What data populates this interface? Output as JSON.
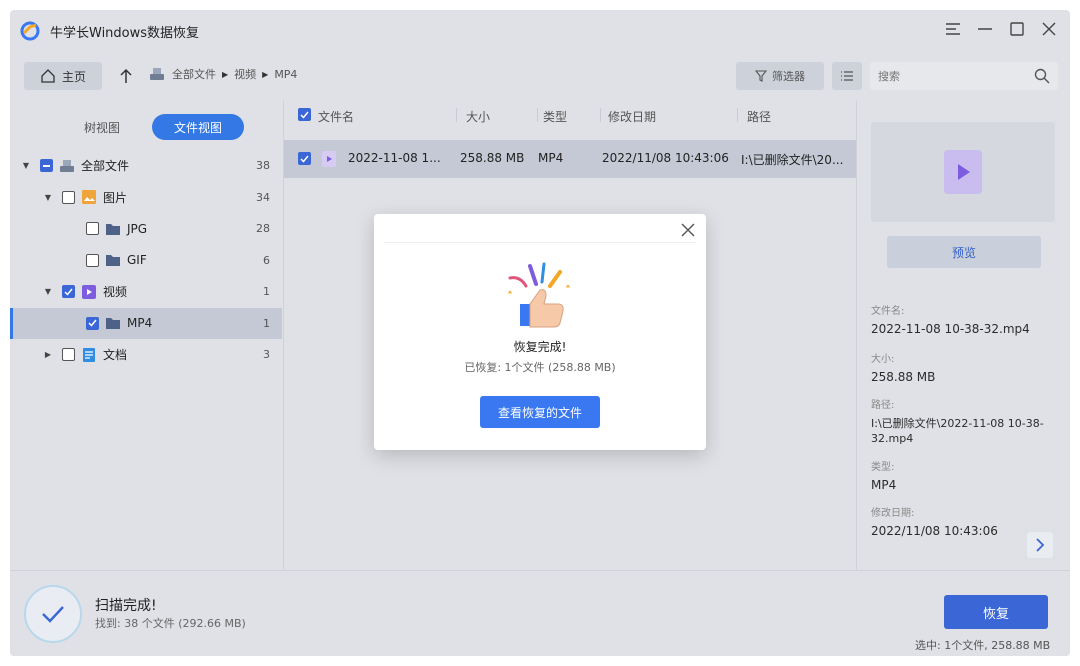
{
  "app": {
    "title": "牛学长Windows数据恢复"
  },
  "toolbar": {
    "home_label": "主页",
    "breadcrumb": [
      "全部文件",
      "视频",
      "MP4"
    ],
    "filter_label": "筛选器",
    "search_placeholder": "搜索"
  },
  "left": {
    "tabs": [
      "树视图",
      "文件视图"
    ],
    "active_tab": "文件视图",
    "tree": [
      {
        "label": "全部文件",
        "count": "38",
        "state": "partial",
        "expanded": true,
        "level": 0
      },
      {
        "label": "图片",
        "count": "34",
        "state": "unchecked",
        "expanded": true,
        "level": 1
      },
      {
        "label": "JPG",
        "count": "28",
        "state": "unchecked",
        "level": 2
      },
      {
        "label": "GIF",
        "count": "6",
        "state": "unchecked",
        "level": 2
      },
      {
        "label": "视频",
        "count": "1",
        "state": "checked",
        "expanded": true,
        "level": 1
      },
      {
        "label": "MP4",
        "count": "1",
        "state": "checked",
        "level": 2,
        "selected": true
      },
      {
        "label": "文档",
        "count": "3",
        "state": "unchecked",
        "expanded": false,
        "level": 1
      }
    ]
  },
  "list": {
    "headers": {
      "name": "文件名",
      "size": "大小",
      "type": "类型",
      "date": "修改日期",
      "path": "路径"
    },
    "rows": [
      {
        "name": "2022-11-08 1...",
        "size": "258.88 MB",
        "type": "MP4",
        "date": "2022/11/08 10:43:06",
        "path": "I:\\已删除文件\\20..."
      }
    ]
  },
  "detail": {
    "preview_label": "预览",
    "filename_label": "文件名:",
    "filename": "2022-11-08 10-38-32.mp4",
    "size_label": "大小:",
    "size": "258.88 MB",
    "path_label": "路径:",
    "path": "I:\\已删除文件\\2022-11-08 10-38-32.mp4",
    "type_label": "类型:",
    "type": "MP4",
    "date_label": "修改日期:",
    "date": "2022/11/08 10:43:06"
  },
  "status": {
    "title": "扫描完成!",
    "subtitle": "找到: 38 个文件 (292.66 MB)",
    "recover_label": "恢复",
    "selected_info": "选中: 1个文件, 258.88 MB"
  },
  "modal": {
    "title": "恢复完成!",
    "subtitle": "已恢复: 1个文件 (258.88 MB)",
    "button_label": "查看恢复的文件"
  },
  "colors": {
    "accent": "#3a66d6",
    "modal_button": "#3a78f2",
    "panel_bg": "#dfe1e6",
    "selected_row": "#c4c9d5"
  }
}
